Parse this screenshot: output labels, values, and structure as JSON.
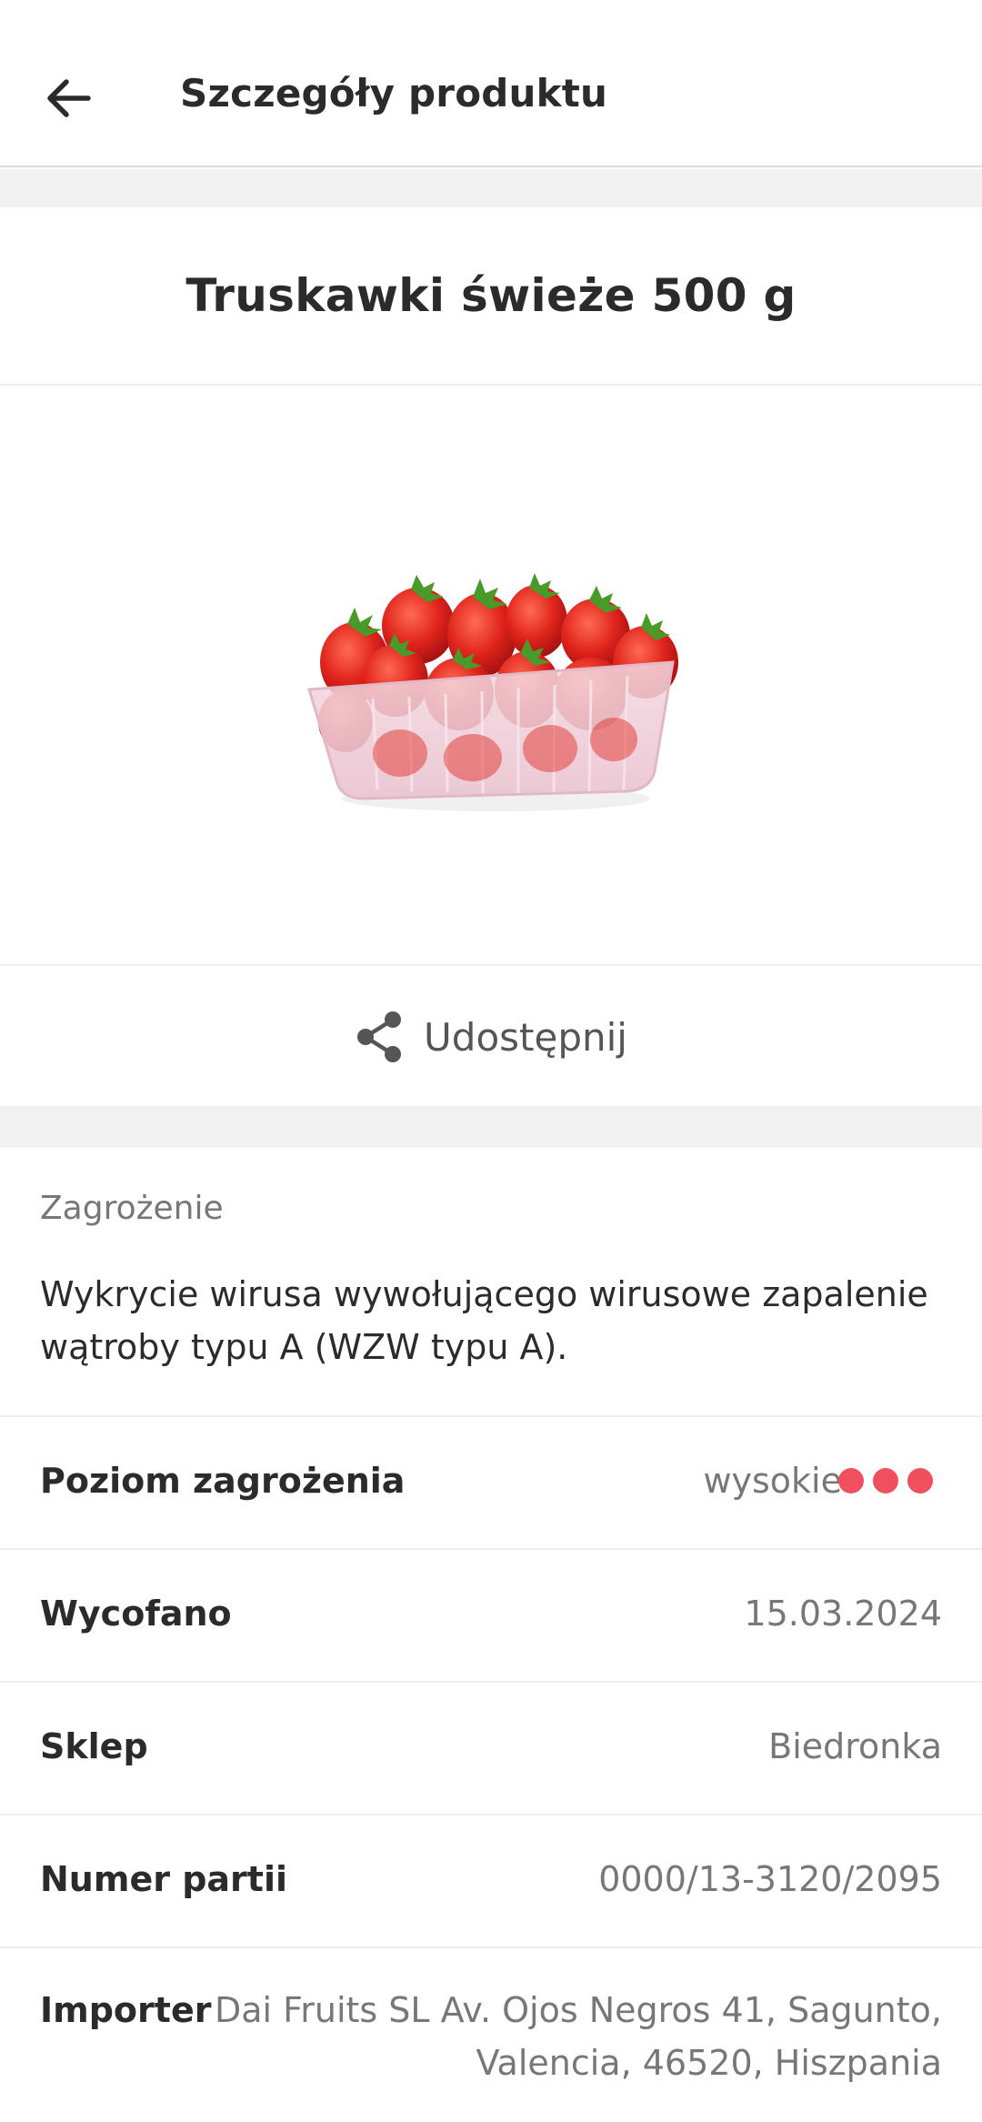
{
  "app_bar": {
    "title": "Szczegóły produktu",
    "back_icon": "arrow-left-icon"
  },
  "product": {
    "name": "Truskawki świeże 500 g",
    "image": "strawberries-in-plastic-punnet"
  },
  "share": {
    "label": "Udostępnij",
    "icon": "share-icon"
  },
  "hazard": {
    "label": "Zagrożenie",
    "description": "Wykrycie wirusa wywołującego wirusowe zapalenie wątroby typu A (WZW typu A)."
  },
  "details": {
    "risk_level": {
      "label": "Poziom zagrożenia",
      "value": "wysokie",
      "dots_filled": 3,
      "dots_total": 3,
      "dot_color": "#f0505e"
    },
    "withdrawn": {
      "label": "Wycofano",
      "value": "15.03.2024"
    },
    "store": {
      "label": "Sklep",
      "value": "Biedronka"
    },
    "batch": {
      "label": "Numer partii",
      "value": "0000/13-3120/2095"
    },
    "importer": {
      "label": "Importer",
      "value_line1": "Dai Fruits SL Av. Ojos Negros 41, Sagunto,",
      "value_line2": "Valencia, 46520, Hiszpania"
    }
  }
}
